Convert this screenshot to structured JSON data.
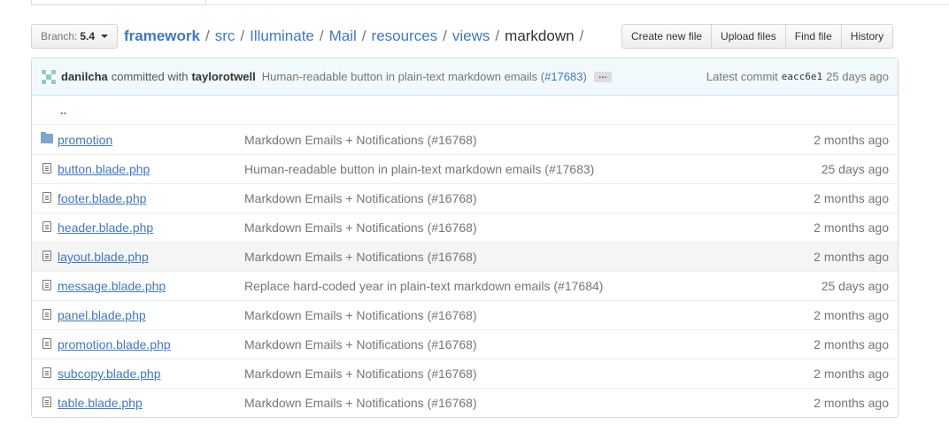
{
  "branch": {
    "label": "Branch:",
    "value": "5.4"
  },
  "breadcrumb": {
    "root": "framework",
    "parts": [
      "src",
      "Illuminate",
      "Mail",
      "resources",
      "views"
    ],
    "current": "markdown",
    "separator": "/"
  },
  "actions": {
    "create": "Create new file",
    "upload": "Upload files",
    "find": "Find file",
    "history": "History"
  },
  "commit": {
    "author": "danilcha",
    "committed_with": "committed with",
    "committer": "taylorotwell",
    "message": "Human-readable button in plain-text markdown emails (",
    "pr": "#17683",
    "message_end": ")",
    "ellipsis": "…",
    "latest_label": "Latest commit",
    "sha": "eacc6e1",
    "age": "25 days ago"
  },
  "parent_dir": "..",
  "files": [
    {
      "type": "folder",
      "icon": "folder-icon",
      "name": "promotion",
      "message": "Markdown Emails + Notifications (#16768)",
      "age": "2 months ago"
    },
    {
      "type": "file",
      "icon": "file-icon",
      "name": "button.blade.php",
      "message": "Human-readable button in plain-text markdown emails (#17683)",
      "age": "25 days ago"
    },
    {
      "type": "file",
      "icon": "file-icon",
      "name": "footer.blade.php",
      "message": "Markdown Emails + Notifications (#16768)",
      "age": "2 months ago"
    },
    {
      "type": "file",
      "icon": "file-icon",
      "name": "header.blade.php",
      "message": "Markdown Emails + Notifications (#16768)",
      "age": "2 months ago"
    },
    {
      "type": "file",
      "icon": "file-icon",
      "name": "layout.blade.php",
      "message": "Markdown Emails + Notifications (#16768)",
      "age": "2 months ago"
    },
    {
      "type": "file",
      "icon": "file-icon",
      "name": "message.blade.php",
      "message": "Replace hard-coded year in plain-text markdown emails (#17684)",
      "age": "25 days ago"
    },
    {
      "type": "file",
      "icon": "file-icon",
      "name": "panel.blade.php",
      "message": "Markdown Emails + Notifications (#16768)",
      "age": "2 months ago"
    },
    {
      "type": "file",
      "icon": "file-icon",
      "name": "promotion.blade.php",
      "message": "Markdown Emails + Notifications (#16768)",
      "age": "2 months ago"
    },
    {
      "type": "file",
      "icon": "file-icon",
      "name": "subcopy.blade.php",
      "message": "Markdown Emails + Notifications (#16768)",
      "age": "2 months ago"
    },
    {
      "type": "file",
      "icon": "file-icon",
      "name": "table.blade.php",
      "message": "Markdown Emails + Notifications (#16768)",
      "age": "2 months ago"
    }
  ],
  "colors": {
    "link": "#4078c0",
    "commit_bar": "#f2f9fc",
    "folder": "#80a6cd"
  }
}
